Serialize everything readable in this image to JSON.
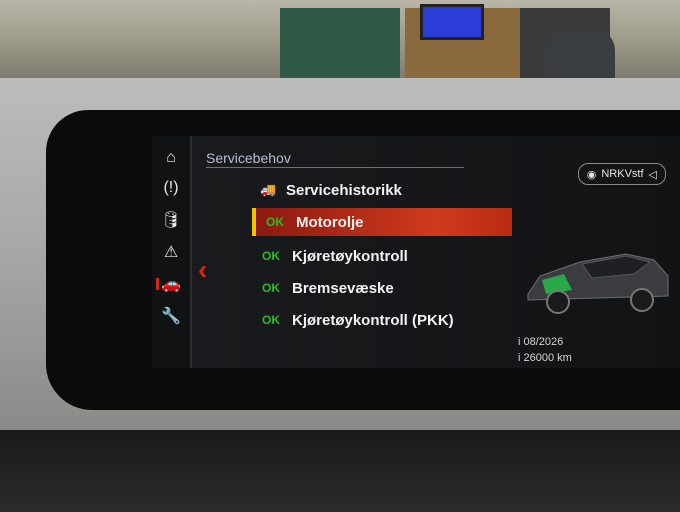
{
  "screen": {
    "page_title": "Servicebehov",
    "media_source": "NRKVstf",
    "side_nav": [
      {
        "icon": "home-icon",
        "glyph": "⌂"
      },
      {
        "icon": "tire-pressure-icon",
        "glyph": "(!)"
      },
      {
        "icon": "oil-can-icon",
        "glyph": "🛢"
      },
      {
        "icon": "warning-triangle-icon",
        "glyph": "⚠"
      },
      {
        "icon": "car-service-icon",
        "glyph": "🚗"
      },
      {
        "icon": "wrench-icon",
        "glyph": "🔧"
      }
    ],
    "menu": [
      {
        "label": "Servicehistorikk",
        "status": "",
        "type": "header"
      },
      {
        "label": "Motorolje",
        "status": "OK",
        "type": "selected"
      },
      {
        "label": "Kjøretøykontroll",
        "status": "OK",
        "type": "item"
      },
      {
        "label": "Bremsevæske",
        "status": "OK",
        "type": "item"
      },
      {
        "label": "Kjøretøykontroll (PKK)",
        "status": "OK",
        "type": "item"
      }
    ],
    "service_due": {
      "date": "i 08/2026",
      "distance": "i 26000 km"
    },
    "colors": {
      "accent": "#d0281b",
      "ok": "#22c01e",
      "selection_border": "#f1c400"
    }
  }
}
